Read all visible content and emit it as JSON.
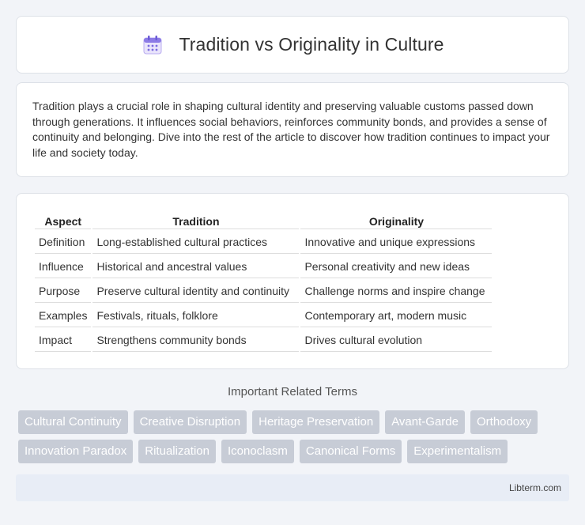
{
  "header": {
    "title": "Tradition vs Originality in Culture",
    "icon": "calendar-icon"
  },
  "intro": {
    "text": "Tradition plays a crucial role in shaping cultural identity and preserving valuable customs passed down through generations. It influences social behaviors, reinforces community bonds, and provides a sense of continuity and belonging. Dive into the rest of the article to discover how tradition continues to impact your life and society today."
  },
  "table": {
    "headers": [
      "Aspect",
      "Tradition",
      "Originality"
    ],
    "rows": [
      [
        "Definition",
        "Long-established cultural practices",
        "Innovative and unique expressions"
      ],
      [
        "Influence",
        "Historical and ancestral values",
        "Personal creativity and new ideas"
      ],
      [
        "Purpose",
        "Preserve cultural identity and continuity",
        "Challenge norms and inspire change"
      ],
      [
        "Examples",
        "Festivals, rituals, folklore",
        "Contemporary art, modern music"
      ],
      [
        "Impact",
        "Strengthens community bonds",
        "Drives cultural evolution"
      ]
    ]
  },
  "related": {
    "title": "Important Related Terms",
    "row1": [
      "Cultural Continuity",
      "Creative Disruption",
      "Heritage Preservation",
      "Avant-Garde",
      "Orthodoxy"
    ],
    "row2": [
      "Innovation Paradox",
      "Ritualization",
      "Iconoclasm",
      "Canonical Forms",
      "Experimentalism"
    ]
  },
  "footer": {
    "text": "Libterm.com"
  }
}
